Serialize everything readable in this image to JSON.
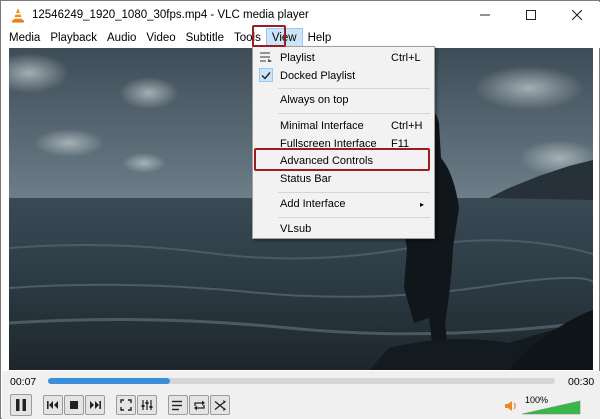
{
  "window": {
    "title": "12546249_1920_1080_30fps.mp4 - VLC media player",
    "controls": [
      "minimize-icon",
      "maximize-icon",
      "close-icon"
    ]
  },
  "menubar": {
    "items": [
      {
        "label": "Media"
      },
      {
        "label": "Playback"
      },
      {
        "label": "Audio"
      },
      {
        "label": "Video"
      },
      {
        "label": "Subtitle"
      },
      {
        "label": "Tools"
      },
      {
        "label": "View",
        "active": true
      },
      {
        "label": "Help"
      }
    ]
  },
  "view_menu": {
    "items": [
      {
        "label": "Playlist",
        "shortcut": "Ctrl+L",
        "icon": "playlist-icon"
      },
      {
        "label": "Docked Playlist",
        "checked": true,
        "icon": "checkmark-icon"
      },
      {
        "label": "Always on top"
      },
      {
        "label": "Minimal Interface",
        "shortcut": "Ctrl+H"
      },
      {
        "label": "Fullscreen Interface",
        "shortcut": "F11"
      },
      {
        "label": "Advanced Controls",
        "highlighted_by_annotation": true
      },
      {
        "label": "Status Bar"
      },
      {
        "label": "Add Interface",
        "submenu": true,
        "arrow": "▸"
      },
      {
        "label": "VLsub"
      }
    ]
  },
  "playback": {
    "elapsed": "00:07",
    "total": "00:30",
    "progress_fraction": 0.24
  },
  "volume": {
    "percent_label": "100%",
    "level_fraction": 1.0
  },
  "controls": [
    "pause-icon",
    "previous-icon",
    "stop-icon",
    "next-icon",
    "fullscreen-icon",
    "extended-settings-icon",
    "playlist-toggle-icon",
    "loop-icon",
    "shuffle-icon"
  ],
  "colors": {
    "accent": "#3b8ed8",
    "annotation": "#9b1c22",
    "menu_active": "#cce4f7",
    "volume_green": "#3bb54a"
  }
}
